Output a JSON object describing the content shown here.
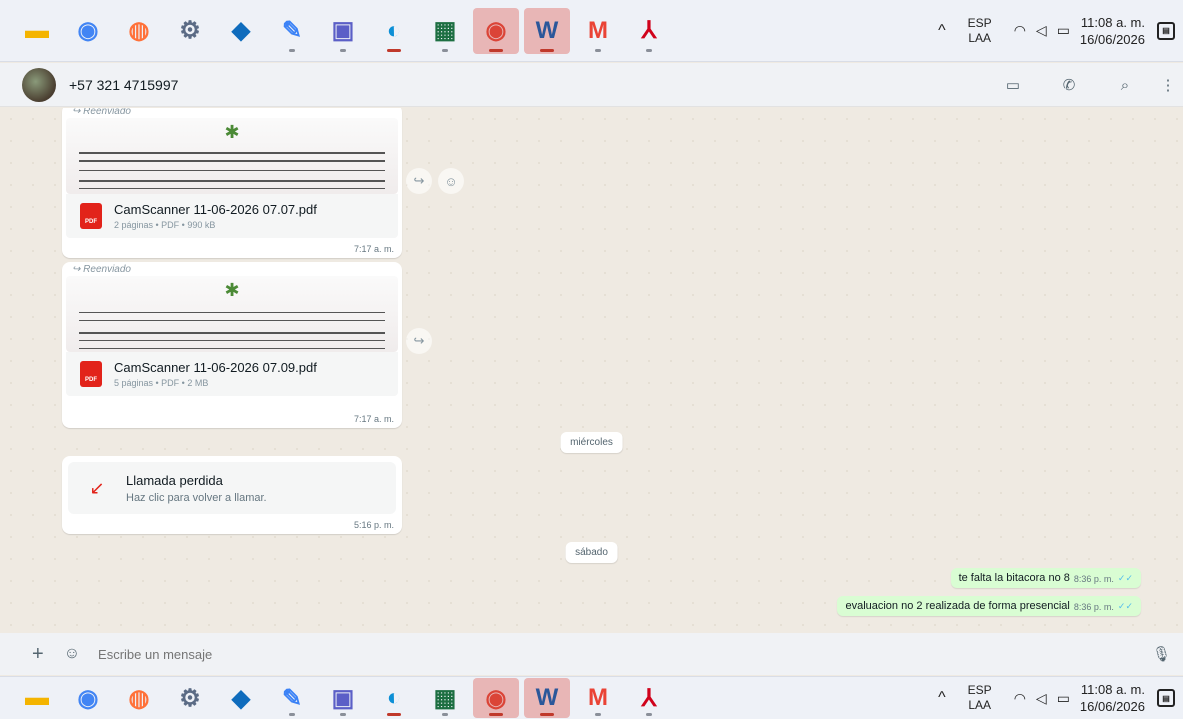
{
  "taskbar": {
    "apps": [
      {
        "name": "file-explorer-icon",
        "glyph": "▬",
        "color": "#f4b400",
        "hl": false,
        "dot": false
      },
      {
        "name": "chrome-icon",
        "glyph": "◉",
        "color": "#4285f4",
        "hl": false,
        "dot": false
      },
      {
        "name": "firefox-icon",
        "glyph": "◍",
        "color": "#ff7139",
        "hl": false,
        "dot": false
      },
      {
        "name": "settings-icon",
        "glyph": "⚙",
        "color": "#5b6b85",
        "hl": false,
        "dot": false
      },
      {
        "name": "outlook-icon",
        "glyph": "◆",
        "color": "#0f6cbd",
        "hl": false,
        "dot": false
      },
      {
        "name": "blue-app-icon",
        "glyph": "✎",
        "color": "#3b82f6",
        "hl": false,
        "dot": true
      },
      {
        "name": "teams-icon",
        "glyph": "▣",
        "color": "#5b5fc7",
        "hl": false,
        "dot": true
      },
      {
        "name": "edge-icon",
        "glyph": "◐",
        "color": "#0c8fd6",
        "hl": false,
        "dot": true,
        "red": true
      },
      {
        "name": "excel-icon",
        "glyph": "▦",
        "color": "#1d6f42",
        "hl": false,
        "dot": true
      },
      {
        "name": "chrome-active-icon",
        "glyph": "◉",
        "color": "#db4437",
        "hl": true,
        "dot": true,
        "red": true
      },
      {
        "name": "word-icon",
        "glyph": "W",
        "color": "#2b579a",
        "hl": true,
        "dot": true,
        "red": true
      },
      {
        "name": "gmail-icon",
        "glyph": "M",
        "color": "#ea4335",
        "hl": false,
        "dot": true
      },
      {
        "name": "acrobat-icon",
        "glyph": "⅄",
        "color": "#d0021b",
        "hl": false,
        "dot": true
      }
    ],
    "lang_top": "ESP",
    "lang_bottom": "LAA",
    "time": "11:08 a. m.",
    "date": "16/06/2026"
  },
  "header": {
    "contact": "+57 321 4715997"
  },
  "messages": {
    "doc1": {
      "forwarded": "Reenviado",
      "name": "CamScanner 11-06-2026 07.07.pdf",
      "meta": "2 páginas • PDF • 990 kB",
      "time": "7:17 a. m."
    },
    "doc2": {
      "forwarded": "Reenviado",
      "name": "CamScanner 11-06-2026 07.09.pdf",
      "meta": "5 páginas • PDF • 2 MB",
      "time": "7:17 a. m."
    },
    "day1": "miércoles",
    "call": {
      "title": "Llamada perdida",
      "subtitle": "Haz clic para volver a llamar.",
      "time": "5:16 p. m."
    },
    "day2": "sábado",
    "out1": {
      "text": "te falta la bitacora no 8",
      "time": "8:36 p. m."
    },
    "out2": {
      "text": "evaluacion no 2 realizada de forma presencial",
      "time": "8:36 p. m."
    }
  },
  "composer": {
    "placeholder": "Escribe un mensaje"
  }
}
